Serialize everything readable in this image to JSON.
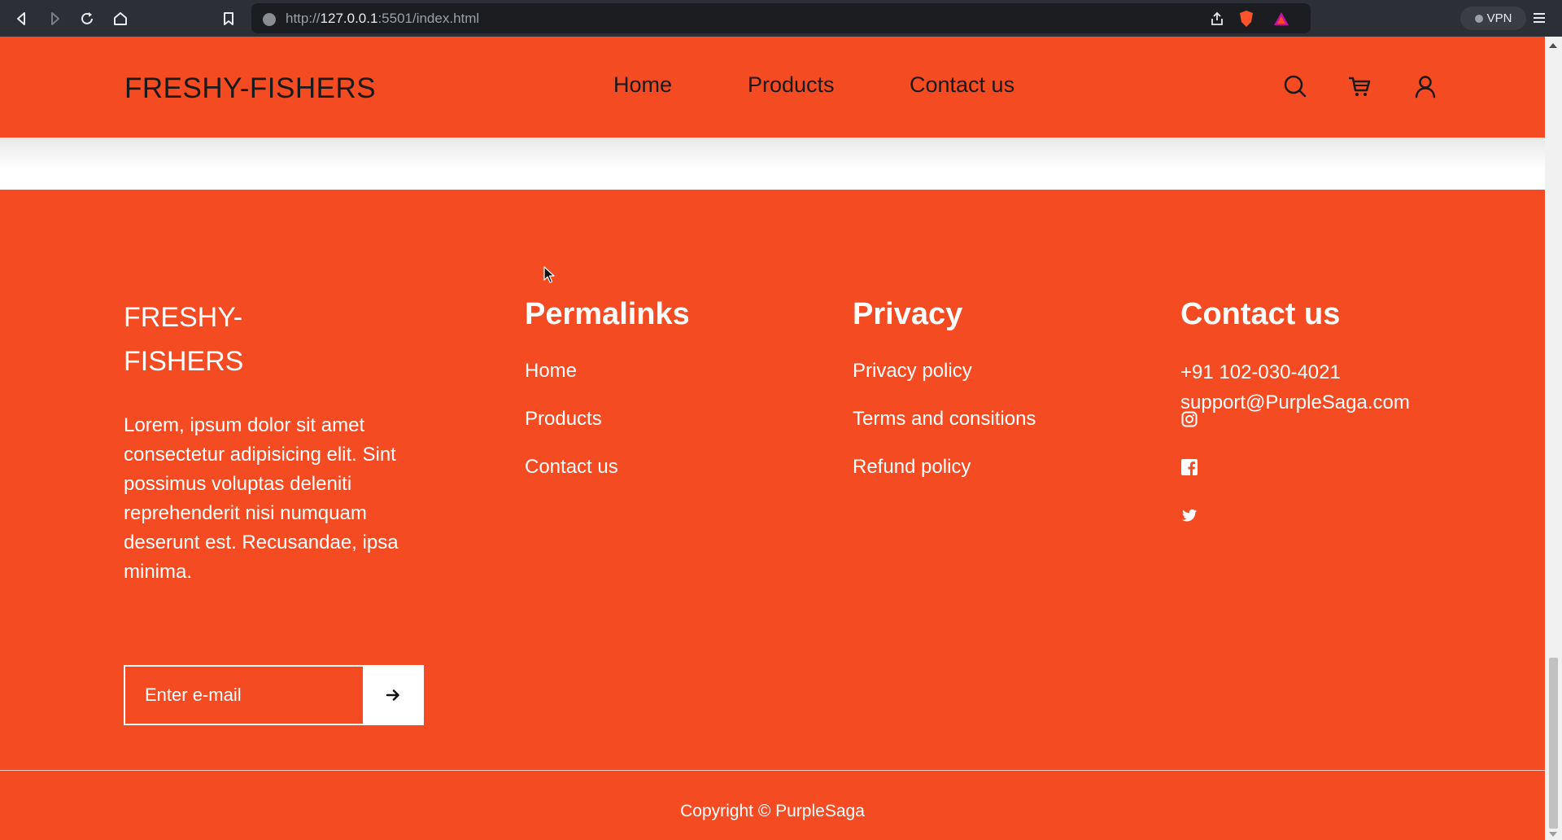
{
  "browser": {
    "url_prefix": "http://",
    "url_host": "127.0.0.1",
    "url_rest": ":5501/index.html",
    "vpn_label": "VPN"
  },
  "header": {
    "logo": "FRESHY-FISHERS",
    "nav": [
      {
        "label": "Home"
      },
      {
        "label": "Products"
      },
      {
        "label": "Contact us"
      }
    ],
    "icons": [
      "search-icon",
      "cart-icon",
      "user-icon"
    ]
  },
  "footer": {
    "brand": "FRESHY-FISHERS",
    "description": "Lorem, ipsum dolor sit amet consectetur adipisicing elit. Sint possimus voluptas deleniti reprehenderit nisi numquam deserunt est. Recusandae, ipsa minima.",
    "email_placeholder": "Enter e-mail",
    "permalinks": {
      "title": "Permalinks",
      "links": [
        "Home",
        "Products",
        "Contact us"
      ]
    },
    "privacy": {
      "title": "Privacy",
      "links": [
        "Privacy policy",
        "Terms and consitions",
        "Refund policy"
      ]
    },
    "contact": {
      "title": "Contact us",
      "phone": "+91 102-030-4021",
      "email": "support@PurpleSaga.com",
      "socials": [
        "instagram-icon",
        "facebook-icon",
        "twitter-icon"
      ]
    },
    "copyright": "Copyright © PurpleSaga"
  },
  "colors": {
    "brand": "#f44b22",
    "text_dark": "#1a1a1a",
    "text_light": "#ffffff"
  }
}
